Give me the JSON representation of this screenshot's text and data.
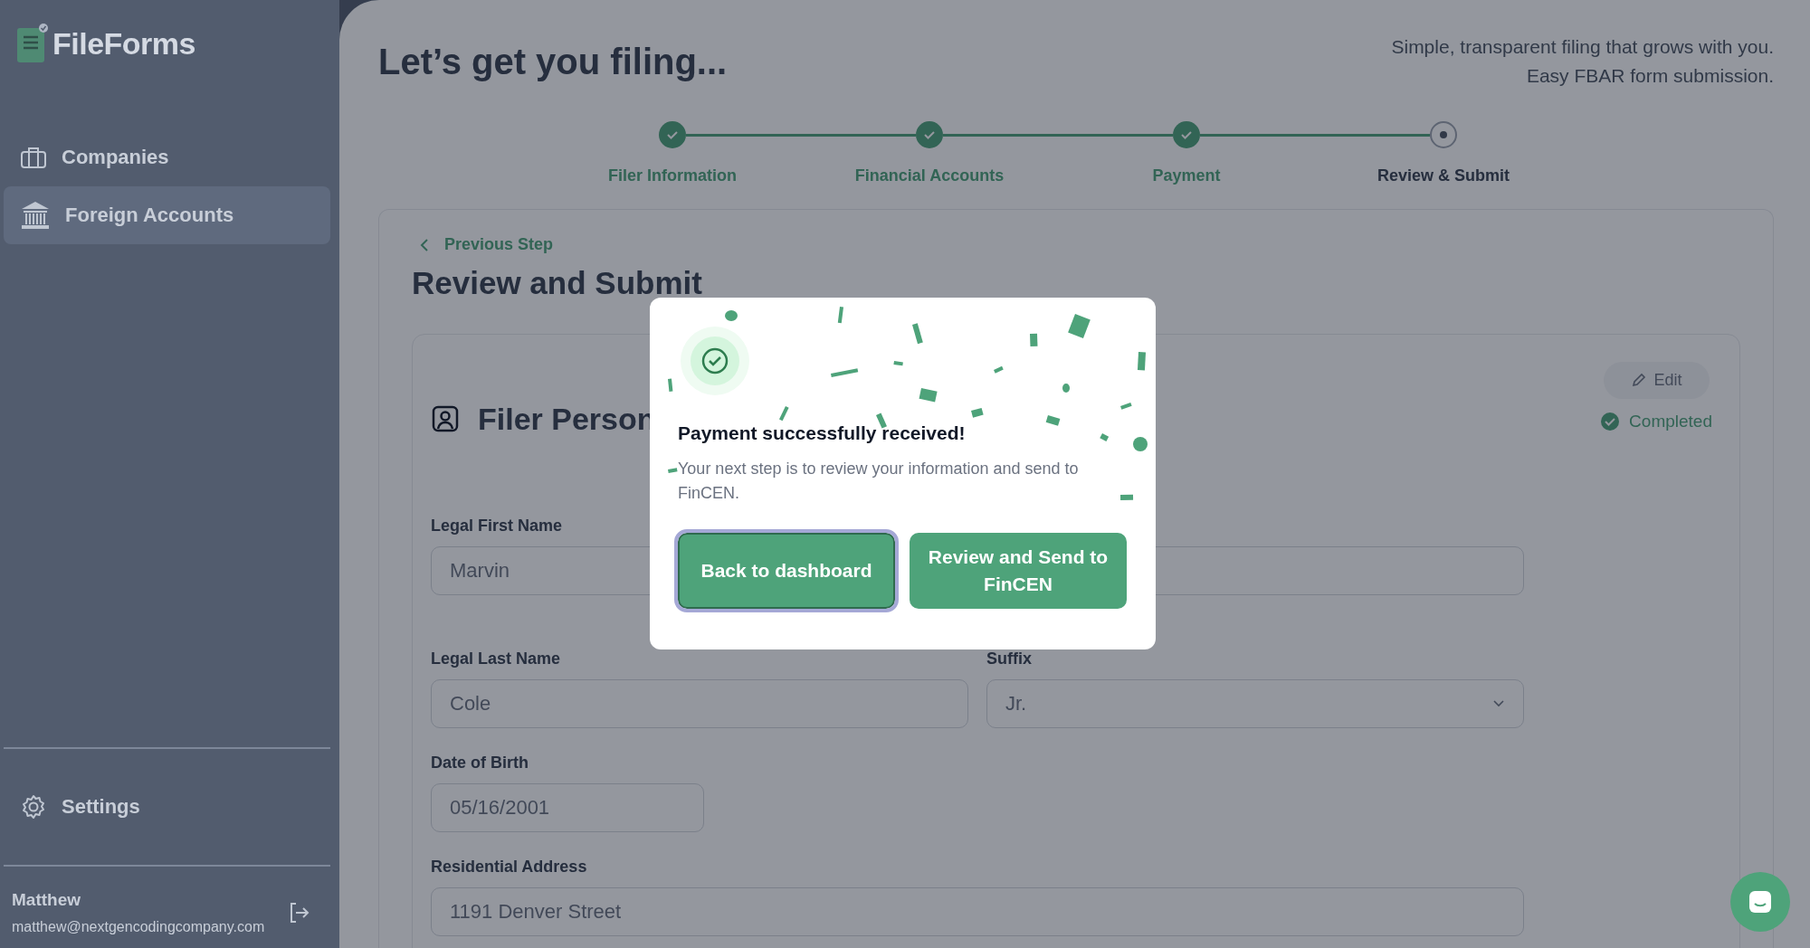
{
  "sidebar": {
    "logo": "FileForms",
    "items": [
      {
        "label": "Companies",
        "selected": false
      },
      {
        "label": "Foreign Accounts",
        "selected": true
      }
    ],
    "settings": "Settings",
    "user": {
      "name": "Matthew",
      "email": "matthew@nextgencodingcompany.com"
    }
  },
  "header": {
    "title": "Let’s get you filing...",
    "tagline": [
      "Simple, transparent filing that grows with you.",
      "Easy FBAR form submission."
    ]
  },
  "steps": [
    {
      "label": "Filer Information",
      "completed": true
    },
    {
      "label": "Financial Accounts",
      "completed": true
    },
    {
      "label": "Payment",
      "completed": true
    },
    {
      "label": "Review & Submit",
      "completed": false
    }
  ],
  "panel": {
    "back": "Previous Step",
    "title": "Review and Submit",
    "section": {
      "title": "Filer Person",
      "edit": "Edit",
      "status": "Completed",
      "rows": [
        [
          {
            "label": "Legal First Name",
            "value": "Marvin",
            "kind": "text"
          },
          {
            "kind": "text"
          }
        ],
        [
          {
            "label": "Legal Last Name",
            "value": "Cole",
            "kind": "text"
          },
          {
            "label": "Suffix",
            "value": "Jr.",
            "kind": "select"
          }
        ],
        [
          {
            "label": "Date of Birth",
            "value": "05/16/2001",
            "kind": "date"
          }
        ],
        [
          {
            "label": "Residential Address",
            "value": "1191 Denver Street",
            "kind": "address"
          }
        ]
      ]
    }
  },
  "modal": {
    "title": "Payment successfully received!",
    "text": "Your next step is to review your information and send to FinCEN.",
    "buttons": [
      {
        "label": "Back to dashboard",
        "focused": true
      },
      {
        "label": "Review and Send to FinCEN",
        "focused": false
      }
    ]
  }
}
